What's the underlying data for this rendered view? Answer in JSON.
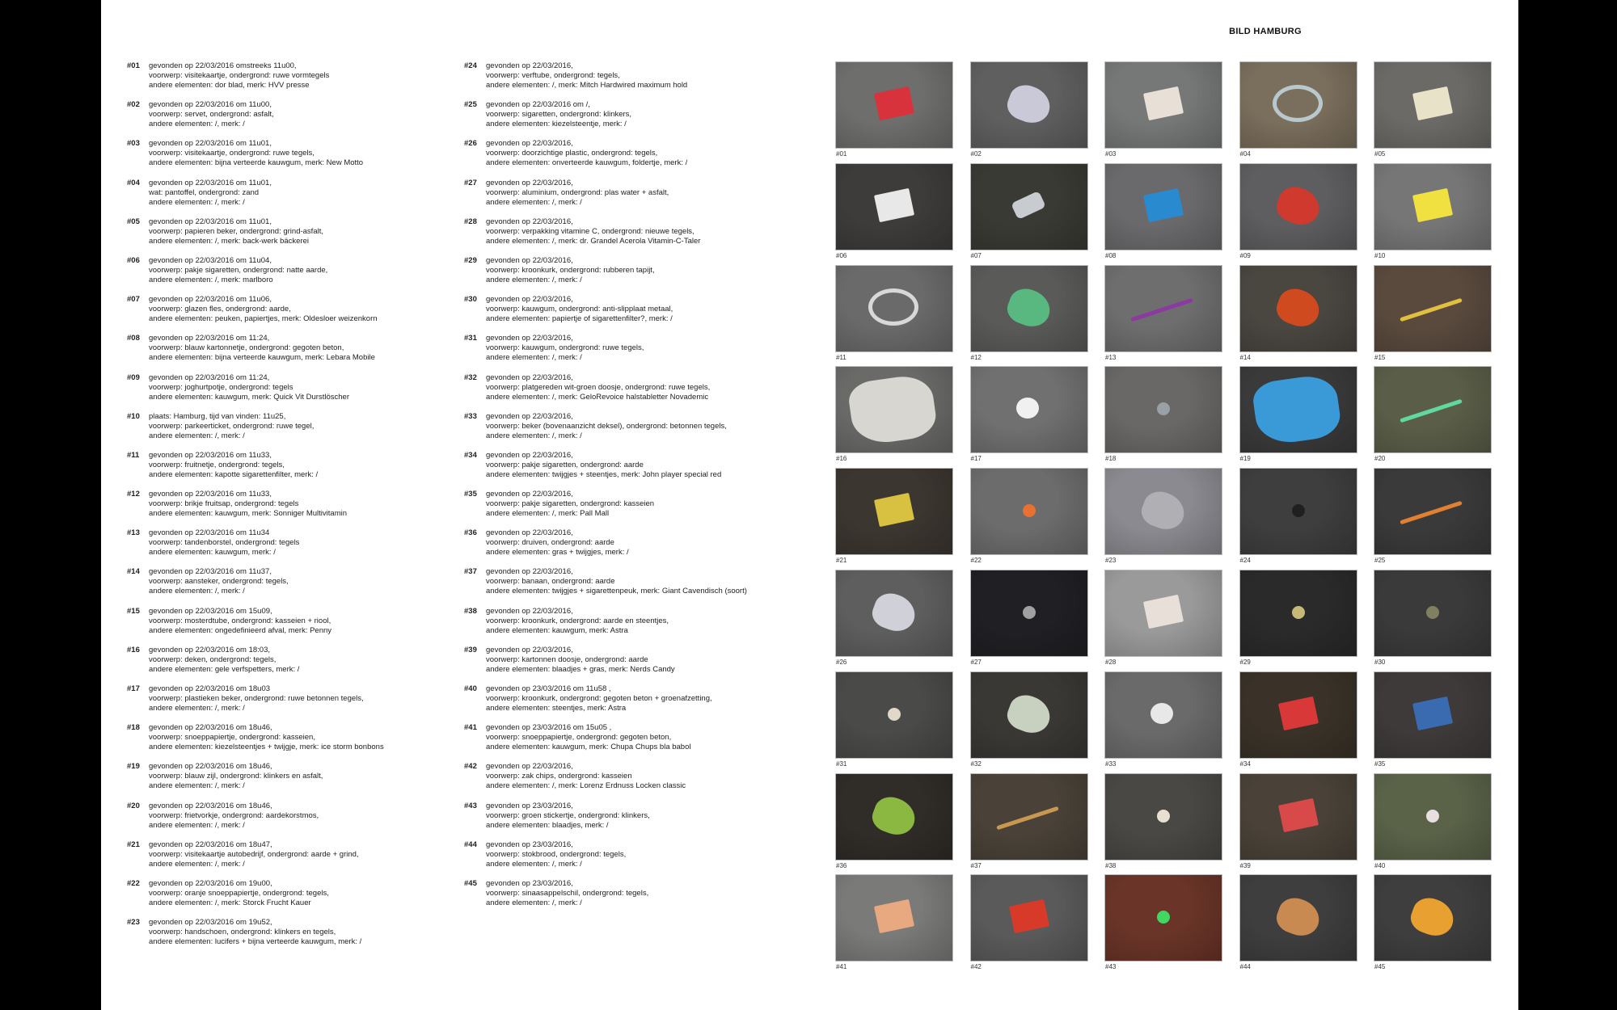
{
  "gallery": {
    "title": "BILD HAMBURG"
  },
  "entries_left": [
    {
      "num": "#01",
      "lines": [
        "gevonden op 22/03/2016 omstreeks 11u00,",
        "voorwerp: visitekaartje, ondergrond: ruwe vormtegels",
        "andere elementen: dor blad, merk: HVV presse"
      ]
    },
    {
      "num": "#02",
      "lines": [
        "gevonden op 22/03/2016 om 11u00,",
        "voorwerp: servet, ondergrond: asfalt,",
        "andere elementen: /, merk: /"
      ]
    },
    {
      "num": "#03",
      "lines": [
        "gevonden op 22/03/2016 om 11u01,",
        "voorwerp: visitekaartje, ondergrond: ruwe tegels,",
        "andere elementen: bijna verteerde kauwgum, merk: New Motto"
      ]
    },
    {
      "num": "#04",
      "lines": [
        "gevonden op 22/03/2016 om 11u01,",
        "wat: pantoffel, ondergrond: zand",
        "andere elementen: /, merk: /"
      ]
    },
    {
      "num": "#05",
      "lines": [
        "gevonden op 22/03/2016 om 11u01,",
        "voorwerp: papieren beker, ondergrond: grind-asfalt,",
        " andere elementen: /, merk: back-werk bäckerei"
      ]
    },
    {
      "num": "#06",
      "lines": [
        " gevonden op 22/03/2016 om 11u04,",
        "voorwerp: pakje sigaretten, ondergrond: natte aarde,",
        "andere elementen: /, merk: marlboro"
      ]
    },
    {
      "num": "#07",
      "lines": [
        "gevonden op 22/03/2016 om 11u06,",
        "voorwerp: glazen fles, ondergrond: aarde,",
        "andere elementen: peuken, papiertjes, merk: Oldesloer weizenkorn"
      ]
    },
    {
      "num": "#08",
      "lines": [
        "gevonden op 22/03/2016 om 11:24,",
        "voorwerp: blauw kartonnetje, ondergrond: gegoten beton,",
        "andere elementen: bijna verteerde kauwgum, merk: Lebara Mobile"
      ]
    },
    {
      "num": "#09",
      "lines": [
        "gevonden op 22/03/2016 om 11:24,",
        "voorwerp: joghurtpotje, ondergrond: tegels",
        "andere elementen: kauwgum, merk: Quick Vit Durstlöscher"
      ]
    },
    {
      "num": "#10",
      "lines": [
        "plaats: Hamburg, tijd van vinden: 11u25,",
        "voorwerp: parkeerticket, ondergrond: ruwe tegel,",
        "andere elementen: /, merk: /"
      ]
    },
    {
      "num": "#11",
      "lines": [
        "gevonden op 22/03/2016 om 11u33,",
        "voorwerp: fruitnetje, ondergrond: tegels,",
        "andere elementen: kapotte sigarettenfilter, merk: /"
      ]
    },
    {
      "num": "#12",
      "lines": [
        "gevonden op 22/03/2016 om 11u33,",
        "voorwerp: brikje fruitsap, ondergrond: tegels",
        "andere elementen: kauwgum, merk: Sonniger Multivitamin"
      ]
    },
    {
      "num": "#13",
      "lines": [
        "gevonden op 22/03/2016 om 11u34",
        "voorwerp: tandenborstel, ondergrond: tegels",
        "andere elementen: kauwgum, merk: /"
      ]
    },
    {
      "num": "#14",
      "lines": [
        "gevonden op 22/03/2016 om 11u37,",
        "voorwerp: aansteker, ondergrond: tegels,",
        "andere elementen: /, merk: /"
      ]
    },
    {
      "num": "#15",
      "lines": [
        "gevonden op 22/03/2016 om 15u09,",
        "voorwerp: mosterdtube, ondergrond: kasseien + riool,",
        "andere elementen: ongedefinieerd afval, merk: Penny"
      ]
    },
    {
      "num": "#16",
      "lines": [
        "gevonden op 22/03/2016 om 18:03,",
        "voorwerp: deken, ondergrond: tegels,",
        "andere elementen: gele verfspetters, merk: /"
      ]
    },
    {
      "num": "#17",
      "lines": [
        "gevonden op 22/03/2016 om 18u03",
        "voorwerp: plastieken beker, ondergrond: ruwe betonnen tegels,",
        "andere elementen: /, merk: /"
      ]
    },
    {
      "num": "#18",
      "lines": [
        "gevonden op 22/03/2016 om 18u46,",
        "voorwerp: snoeppapiertje, ondergrond: kasseien,",
        "andere elementen: kiezelsteentjes + twijgje, merk: ice storm bonbons"
      ]
    },
    {
      "num": "#19",
      "lines": [
        "gevonden op 22/03/2016 om 18u46,",
        "voorwerp: blauw zijl, ondergrond: klinkers en asfalt,",
        "andere elementen: /, merk: /"
      ]
    },
    {
      "num": "#20",
      "lines": [
        "gevonden op 22/03/2016 om 18u46,",
        "voorwerp: frietvorkje, ondergrond: aardekorstmos,",
        "andere elementen: /, merk: /"
      ]
    },
    {
      "num": "#21",
      "lines": [
        "gevonden op 22/03/2016 om 18u47,",
        "voorwerp: visitekaartje autobedrijf, ondergrond: aarde + grind,",
        "andere elementen: /, merk: /"
      ]
    },
    {
      "num": "#22",
      "lines": [
        "gevonden op 22/03/2016 om 19u00,",
        "voorwerp: oranje snoeppapiertje, ondergrond: tegels,",
        "andere elementen: /, merk: Storck Frucht Kauer"
      ]
    },
    {
      "num": "#23",
      "lines": [
        "gevonden op 22/03/2016 om 19u52,",
        "voorwerp: handschoen, ondergrond: klinkers en tegels,",
        "andere elementen: lucifers + bijna verteerde kauwgum, merk: /"
      ]
    }
  ],
  "entries_mid": [
    {
      "num": "#24",
      "lines": [
        "gevonden op 22/03/2016,",
        "voorwerp: verftube, ondergrond: tegels,",
        "andere elementen: /, merk: Mitch Hardwired maximum hold"
      ]
    },
    {
      "num": "#25",
      "lines": [
        "gevonden op 22/03/2016 om /,",
        "voorwerp: sigaretten, ondergrond: klinkers,",
        "andere elementen: kiezelsteentje, merk: /"
      ]
    },
    {
      "num": "#26",
      "lines": [
        "gevonden op 22/03/2016,",
        "voorwerp: doorzichtige plastic, ondergrond: tegels,",
        "andere elementen: onverteerde kauwgum, foldertje, merk: /"
      ]
    },
    {
      "num": "#27",
      "lines": [
        "gevonden op 22/03/2016,",
        "voorwerp: aluminium, ondergrond: plas water + asfalt,",
        "andere elementen: /, merk: /"
      ]
    },
    {
      "num": "#28",
      "lines": [
        "gevonden op 22/03/2016,",
        "voorwerp: verpakking vitamine C, ondergrond: nieuwe tegels,",
        "andere elementen: /, merk: dr. Grandel Acerola Vitamin-C-Taler"
      ]
    },
    {
      "num": "#29",
      "lines": [
        "gevonden op 22/03/2016,",
        "voorwerp: kroonkurk, ondergrond: rubberen tapijt,",
        "andere elementen: /, merk: /"
      ]
    },
    {
      "num": "#30",
      "lines": [
        "gevonden op 22/03/2016,",
        "voorwerp: kauwgum, ondergrond: anti-slipplaat metaal,",
        "andere elementen: papiertje of sigarettenfilter?, merk: /"
      ]
    },
    {
      "num": "#31",
      "lines": [
        "gevonden op 22/03/2016,",
        "voorwerp: kauwgum, ondergrond: ruwe tegels,",
        "andere elementen: /, merk: /"
      ]
    },
    {
      "num": "#32",
      "lines": [
        "gevonden op 22/03/2016,",
        "voorwerp: platgereden wit-groen doosje, ondergrond: ruwe tegels,",
        "andere elementen: /, merk: GeloRevoice halstabletter Novademic"
      ]
    },
    {
      "num": "#33",
      "lines": [
        "gevonden op 22/03/2016,",
        "voorwerp: beker (bovenaanzicht deksel), ondergrond: betonnen tegels,",
        "andere elementen: /, merk: /"
      ]
    },
    {
      "num": "#34",
      "lines": [
        "gevonden op 22/03/2016,",
        "voorwerp: pakje sigaretten, ondergrond: aarde",
        "andere elementen: twijgjes + steentjes, merk: John player special red"
      ]
    },
    {
      "num": "#35",
      "lines": [
        "gevonden op 22/03/2016,",
        "voorwerp: pakje sigaretten, ondergrond: kasseien",
        "andere elementen: /, merk: Pall Mall"
      ]
    },
    {
      "num": "#36",
      "lines": [
        "gevonden op 22/03/2016,",
        "voorwerp: druiven, ondergrond: aarde",
        "andere elementen: gras + twijgjes, merk: /"
      ]
    },
    {
      "num": "#37",
      "lines": [
        "gevonden op 22/03/2016,",
        "voorwerp: banaan, ondergrond: aarde",
        "andere elementen: twijgjes + sigarettenpeuk, merk: Giant Cavendisch (soort)"
      ]
    },
    {
      "num": "#38",
      "lines": [
        "gevonden op 22/03/2016,",
        "voorwerp: kroonkurk, ondergrond: aarde en steentjes,",
        "andere elementen: kauwgum, merk: Astra"
      ]
    },
    {
      "num": "#39",
      "lines": [
        "gevonden op 22/03/2016,",
        "voorwerp: kartonnen doosje, ondergrond: aarde",
        "andere elementen: blaadjes + gras, merk: Nerds Candy"
      ]
    },
    {
      "num": "#40",
      "lines": [
        "gevonden op 23/03/2016 om 11u58 ,",
        "voorwerp: kroonkurk, ondergrond: gegoten beton + groenafzetting,",
        "andere elementen: steentjes, merk: Astra"
      ]
    },
    {
      "num": "#41",
      "lines": [
        "gevonden op 23/03/2016 om 15u05 ,",
        "voorwerp: snoeppapiertje, ondergrond: gegoten beton,",
        "andere elementen: kauwgum, merk: Chupa Chups bla babol"
      ]
    },
    {
      "num": "#42",
      "lines": [
        "gevonden op 22/03/2016,",
        "voorwerp: zak chips, ondergrond: kasseien",
        "andere elementen: /, merk: Lorenz Erdnuss Locken classic"
      ]
    },
    {
      "num": "#43",
      "lines": [
        "gevonden op 23/03/2016,",
        "voorwerp: groen stickertje, ondergrond: klinkers,",
        "andere elementen: blaadjes, merk: /"
      ]
    },
    {
      "num": "#44",
      "lines": [
        "gevonden op 23/03/2016,",
        "voorwerp: stokbrood, ondergrond: tegels,",
        "andere elementen: /, merk: /"
      ]
    },
    {
      "num": "#45",
      "lines": [
        "gevonden op 23/03/2016,",
        "voorwerp: sinaasappelschil, ondergrond: tegels,",
        "andere elementen: /, merk: /"
      ]
    }
  ],
  "photos": [
    {
      "label": "#01",
      "bg": "#6e6e6c",
      "obj": "#d8323c",
      "shape": "rect"
    },
    {
      "label": "#02",
      "bg": "#5f5f60",
      "obj": "#c9c9d8",
      "shape": "blob"
    },
    {
      "label": "#03",
      "bg": "#767878",
      "obj": "#e8e0d6",
      "shape": "rect"
    },
    {
      "label": "#04",
      "bg": "#7a6e5c",
      "obj": "#b8c8cc",
      "shape": "ring"
    },
    {
      "label": "#05",
      "bg": "#6c6a66",
      "obj": "#e8e2c8",
      "shape": "rect"
    },
    {
      "label": "#06",
      "bg": "#3e3c3a",
      "obj": "#e8e8e8",
      "shape": "rect"
    },
    {
      "label": "#07",
      "bg": "#3a3a34",
      "obj": "#c8ccd0",
      "shape": "bottle"
    },
    {
      "label": "#08",
      "bg": "#6a6a6c",
      "obj": "#2a8ad0",
      "shape": "rect"
    },
    {
      "label": "#09",
      "bg": "#5e5e60",
      "obj": "#d03a2e",
      "shape": "blob"
    },
    {
      "label": "#10",
      "bg": "#767676",
      "obj": "#f0e040",
      "shape": "rect"
    },
    {
      "label": "#11",
      "bg": "#6a6a6a",
      "obj": "#d8d8d8",
      "shape": "ring"
    },
    {
      "label": "#12",
      "bg": "#5a5a58",
      "obj": "#58b880",
      "shape": "blob"
    },
    {
      "label": "#13",
      "bg": "#6e6e6e",
      "obj": "#8a3aa0",
      "shape": "line"
    },
    {
      "label": "#14",
      "bg": "#4a4640",
      "obj": "#d04a20",
      "shape": "blob"
    },
    {
      "label": "#15",
      "bg": "#5a4a3e",
      "obj": "#e0c040",
      "shape": "line"
    },
    {
      "label": "#16",
      "bg": "#6a6a68",
      "obj": "#d8d6d0",
      "shape": "cloth"
    },
    {
      "label": "#17",
      "bg": "#707070",
      "obj": "#f0f0f0",
      "shape": "cup"
    },
    {
      "label": "#18",
      "bg": "#6a6866",
      "obj": "#9aa0a8",
      "shape": "dot"
    },
    {
      "label": "#19",
      "bg": "#3a3a3a",
      "obj": "#3a9ad8",
      "shape": "cloth"
    },
    {
      "label": "#20",
      "bg": "#5a5e48",
      "obj": "#60d8a0",
      "shape": "line"
    },
    {
      "label": "#21",
      "bg": "#3c3630",
      "obj": "#d8c040",
      "shape": "rect"
    },
    {
      "label": "#22",
      "bg": "#6c6c6c",
      "obj": "#e87030",
      "shape": "dot"
    },
    {
      "label": "#23",
      "bg": "#8a8a90",
      "obj": "#b0b0b4",
      "shape": "blob"
    },
    {
      "label": "#24",
      "bg": "#3e3e3e",
      "obj": "#202020",
      "shape": "dot"
    },
    {
      "label": "#25",
      "bg": "#3a3a3a",
      "obj": "#e08030",
      "shape": "line"
    },
    {
      "label": "#26",
      "bg": "#5e5e5e",
      "obj": "#d0d0d8",
      "shape": "blob"
    },
    {
      "label": "#27",
      "bg": "#202024",
      "obj": "#a0a0a0",
      "shape": "dot"
    },
    {
      "label": "#28",
      "bg": "#9a9a9a",
      "obj": "#e8e0d8",
      "shape": "rect"
    },
    {
      "label": "#29",
      "bg": "#2a2a2a",
      "obj": "#c8b878",
      "shape": "dot"
    },
    {
      "label": "#30",
      "bg": "#3a3a3a",
      "obj": "#808060",
      "shape": "dot"
    },
    {
      "label": "#31",
      "bg": "#4a4a48",
      "obj": "#e0d8c8",
      "shape": "dot"
    },
    {
      "label": "#32",
      "bg": "#3a3834",
      "obj": "#c8d0c0",
      "shape": "blob"
    },
    {
      "label": "#33",
      "bg": "#6a6a6a",
      "obj": "#e8e8e8",
      "shape": "cup"
    },
    {
      "label": "#34",
      "bg": "#3a3228",
      "obj": "#d83838",
      "shape": "rect"
    },
    {
      "label": "#35",
      "bg": "#3e3a3a",
      "obj": "#3a6ab0",
      "shape": "rect"
    },
    {
      "label": "#36",
      "bg": "#302c28",
      "obj": "#8ab840",
      "shape": "blob"
    },
    {
      "label": "#37",
      "bg": "#4a4238",
      "obj": "#c89850",
      "shape": "line"
    },
    {
      "label": "#38",
      "bg": "#4a4844",
      "obj": "#e8e0d0",
      "shape": "dot"
    },
    {
      "label": "#39",
      "bg": "#4a4238",
      "obj": "#d84a4a",
      "shape": "rect"
    },
    {
      "label": "#40",
      "bg": "#5a6248",
      "obj": "#e8e0e0",
      "shape": "dot"
    },
    {
      "label": "#41",
      "bg": "#7a7a78",
      "obj": "#e8a880",
      "shape": "rect"
    },
    {
      "label": "#42",
      "bg": "#5a5a5a",
      "obj": "#d83a2a",
      "shape": "rect"
    },
    {
      "label": "#43",
      "bg": "#6a3428",
      "obj": "#40d860",
      "shape": "dot"
    },
    {
      "label": "#44",
      "bg": "#3e3e3e",
      "obj": "#c88a50",
      "shape": "blob"
    },
    {
      "label": "#45",
      "bg": "#3e3e3e",
      "obj": "#e8a030",
      "shape": "blob"
    }
  ]
}
